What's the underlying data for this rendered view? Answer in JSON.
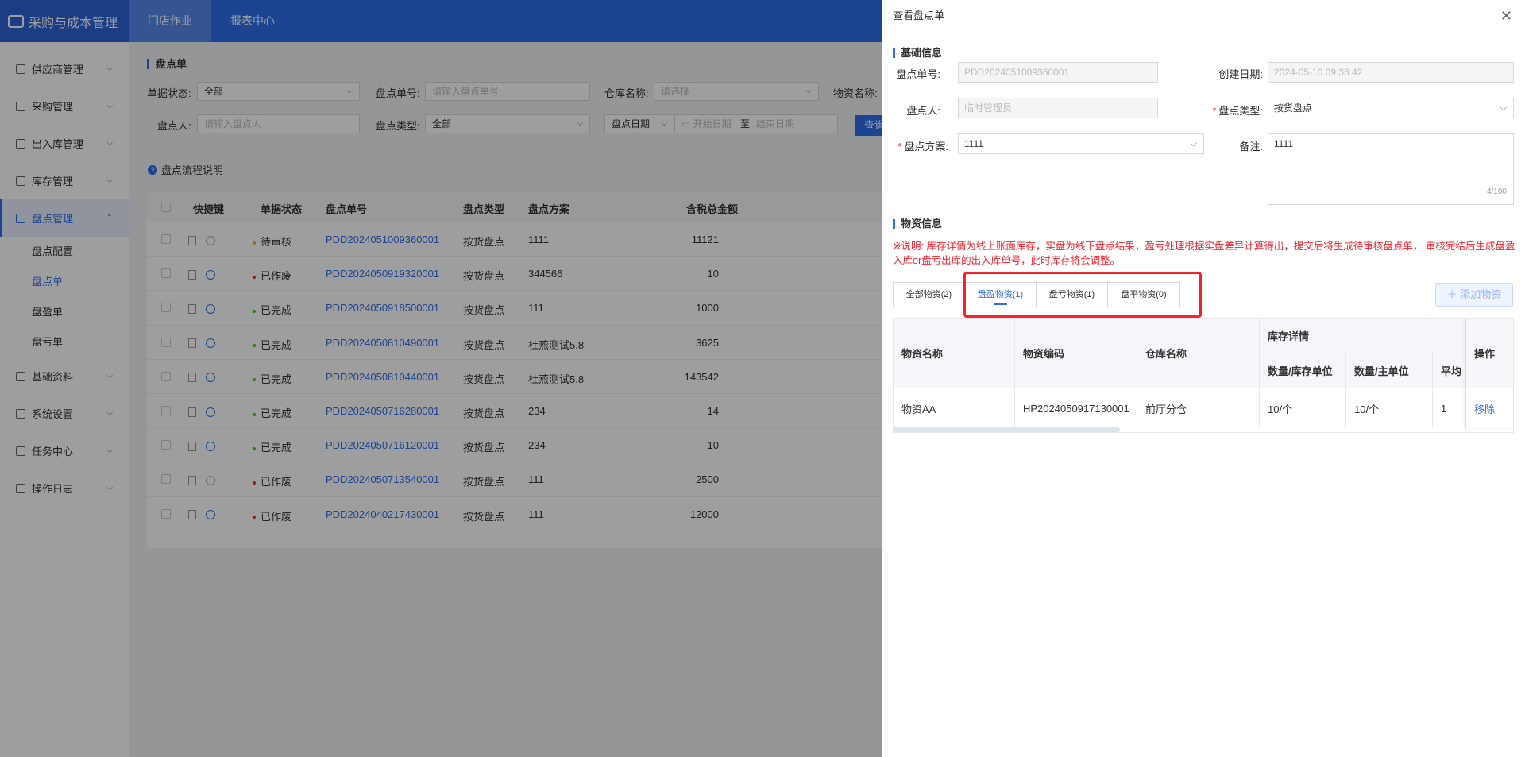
{
  "app": {
    "title": "采购与成本管理"
  },
  "topnav": [
    {
      "label": "门店作业"
    },
    {
      "label": "报表中心"
    }
  ],
  "sidebar": {
    "items": [
      {
        "label": "供应商管理"
      },
      {
        "label": "采购管理"
      },
      {
        "label": "出入库管理"
      },
      {
        "label": "库存管理"
      },
      {
        "label": "盘点管理"
      },
      {
        "label": "基础资料"
      },
      {
        "label": "系统设置"
      },
      {
        "label": "任务中心"
      },
      {
        "label": "操作日志"
      }
    ],
    "subitems": [
      {
        "label": "盘点配置"
      },
      {
        "label": "盘点单"
      },
      {
        "label": "盘盈单"
      },
      {
        "label": "盘亏单"
      }
    ]
  },
  "page": {
    "title": "盘点单",
    "filters": {
      "status_label": "单据状态:",
      "status_value": "全部",
      "no_label": "盘点单号:",
      "no_placeholder": "请输入盘点单号",
      "warehouse_label": "仓库名称:",
      "warehouse_placeholder": "请选择",
      "material_label": "物资名称:",
      "person_label": "盘点人:",
      "person_placeholder": "请输入盘点人",
      "type_label": "盘点类型:",
      "type_value": "全部",
      "date_type": "盘点日期",
      "date_start": "开始日期",
      "date_sep": "至",
      "date_end": "结束日期",
      "search_label": "查询"
    },
    "flow_tip": "盘点流程说明",
    "table": {
      "headers": [
        "快捷键",
        "单据状态",
        "盘点单号",
        "盘点类型",
        "盘点方案",
        "含税总金额"
      ],
      "rows": [
        {
          "status": "待审核",
          "status_color": "#faad14",
          "no": "PDD2024051009360001",
          "type": "按货盘点",
          "plan": "1111",
          "amount": "11121"
        },
        {
          "status": "已作废",
          "status_color": "#f5222d",
          "no": "PDD2024050919320001",
          "type": "按货盘点",
          "plan": "344566",
          "amount": "10"
        },
        {
          "status": "已完成",
          "status_color": "#52c41a",
          "no": "PDD2024050918500001",
          "type": "按货盘点",
          "plan": "111",
          "amount": "1000"
        },
        {
          "status": "已完成",
          "status_color": "#52c41a",
          "no": "PDD2024050810490001",
          "type": "按货盘点",
          "plan": "杜燕测试5.8",
          "amount": "3625"
        },
        {
          "status": "已完成",
          "status_color": "#52c41a",
          "no": "PDD2024050810440001",
          "type": "按货盘点",
          "plan": "杜燕测试5.8",
          "amount": "143542"
        },
        {
          "status": "已完成",
          "status_color": "#52c41a",
          "no": "PDD2024050716280001",
          "type": "按货盘点",
          "plan": "234",
          "amount": "14"
        },
        {
          "status": "已完成",
          "status_color": "#52c41a",
          "no": "PDD2024050716120001",
          "type": "按货盘点",
          "plan": "234",
          "amount": "10"
        },
        {
          "status": "已作废",
          "status_color": "#f5222d",
          "no": "PDD2024050713540001",
          "type": "按货盘点",
          "plan": "111",
          "amount": "2500"
        },
        {
          "status": "已作废",
          "status_color": "#f5222d",
          "no": "PDD2024040217430001",
          "type": "按货盘点",
          "plan": "111",
          "amount": "12000"
        }
      ]
    }
  },
  "drawer": {
    "title": "查看盘点单",
    "basic_title": "基础信息",
    "fields": {
      "no_label": "盘点单号:",
      "no_value": "PDD2024051009360001",
      "date_label": "创建日期:",
      "date_value": "2024-05-10 09:36:42",
      "person_label": "盘点人:",
      "person_value": "临时管理员",
      "type_label": "盘点类型:",
      "type_value": "按货盘点",
      "plan_label": "盘点方案:",
      "plan_value": "1111",
      "remark_label": "备注:",
      "remark_value": "1111",
      "remark_count": "4/100"
    },
    "material_title": "物资信息",
    "note": "※说明: 库存详情为线上账面库存，实盘为线下盘点结果，盈亏处理根据实盘差异计算得出，提交后将生成待审核盘点单， 审核完结后生成盘盈入库or盘亏出库的出入库单号，此时库存将会调整。",
    "tabs": [
      {
        "label": "全部物资(2)"
      },
      {
        "label": "盘盈物资(1)"
      },
      {
        "label": "盘亏物资(1)"
      },
      {
        "label": "盘平物资(0)"
      }
    ],
    "add_button": "添加物资",
    "table": {
      "headers": {
        "name": "物资名称",
        "code": "物资编码",
        "warehouse": "仓库名称",
        "stock_detail": "库存详情",
        "qty_stock_unit": "数量/库存单位",
        "qty_main_unit": "数量/主单位",
        "avg": "平均",
        "op": "操作"
      },
      "row": {
        "name": "物资AA",
        "code": "HP2024050917130001",
        "warehouse": "前厅分仓",
        "qty_stock_unit": "10/个",
        "qty_main_unit": "10/个",
        "avg": "1",
        "op": "移除"
      }
    }
  }
}
